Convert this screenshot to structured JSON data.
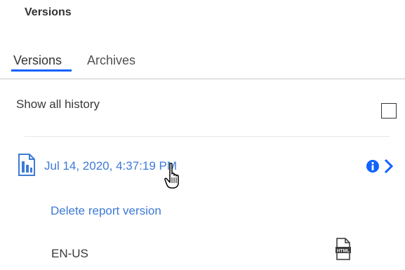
{
  "panel": {
    "title": "Versions"
  },
  "tabs": [
    {
      "label": "Versions",
      "active": true
    },
    {
      "label": "Archives",
      "active": false
    }
  ],
  "history": {
    "label": "Show all history",
    "checked": false
  },
  "version": {
    "timestamp": "Jul 14, 2020, 4:37:19 PM",
    "icon": "report-icon",
    "actions": [
      "info-icon",
      "chevron-right-icon"
    ],
    "delete_label": "Delete report version",
    "locale": "EN-US",
    "output_icon": "html-file-icon",
    "output_icon_text": "HTML"
  },
  "colors": {
    "accent": "#0f62fe",
    "link": "#3d7ad6",
    "text": "#393939"
  }
}
